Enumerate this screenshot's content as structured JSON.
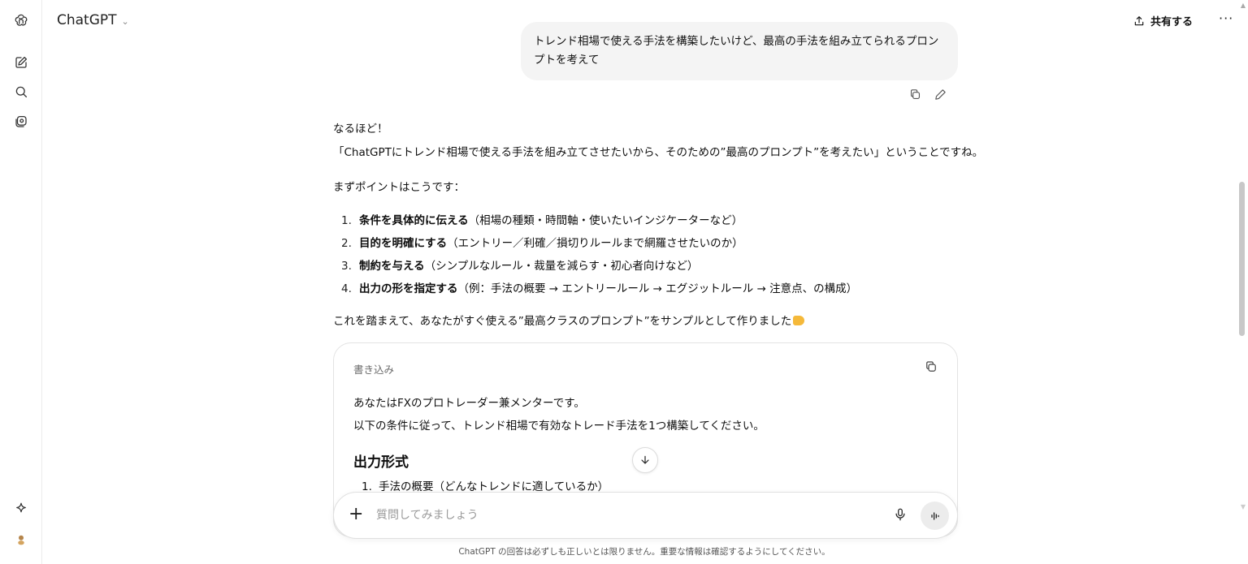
{
  "header": {
    "model_name": "ChatGPT",
    "share_label": "共有する",
    "more_label": "···"
  },
  "conversation": {
    "user_message": {
      "line1": "トレンド相場で使える手法を構築したいけど、最高の手法を組み立てられるプロン",
      "line2": "プトを考えて"
    },
    "assistant": {
      "intro1": "なるほど！",
      "intro2": "「ChatGPTにトレンド相場で使える手法を組み立てさせたいから、そのための”最高のプロンプト”を考えたい」ということですね。",
      "points_intro": "まずポイントはこうです：",
      "points": [
        {
          "num": "1.",
          "bold": "条件を具体的に伝える",
          "rest": "（相場の種類・時間軸・使いたいインジケーターなど）"
        },
        {
          "num": "2.",
          "bold": "目的を明確にする",
          "rest": "（エントリー／利確／損切りルールまで網羅させたいのか）"
        },
        {
          "num": "3.",
          "bold": "制約を与える",
          "rest": "（シンプルなルール・裁量を減らす・初心者向けなど）"
        },
        {
          "num": "4.",
          "bold": "出力の形を指定する",
          "rest": "（例：手法の概要 → エントリールール → エグジットルール → 注意点、の構成）"
        }
      ],
      "outro": "これを踏まえて、あなたがすぐ使える”最高クラスのプロンプト”をサンプルとして作りました",
      "outro_emoji": "backhand-index-pointing-down-emoji"
    },
    "card": {
      "title": "書き込み",
      "line1": "あなたはFXのプロトレーダー兼メンターです。",
      "line2": "以下の条件に従って、トレンド相場で有効なトレード手法を1つ構築してください。",
      "heading": "出力形式",
      "list_num": "1.",
      "list_item": "手法の概要（どんなトレンドに適しているか）"
    }
  },
  "composer": {
    "placeholder": "質問してみましょう",
    "value": ""
  },
  "footer": {
    "disclaimer": "ChatGPT の回答は必ずしも正しいとは限りません。重要な情報は確認するようにしてください。"
  },
  "icons": [
    "openai-logo-icon",
    "new-chat-icon",
    "search-icon",
    "library-icon",
    "sparkle-icon",
    "avatar",
    "share-icon",
    "copy-icon",
    "edit-icon",
    "arrow-down-icon",
    "plus-icon",
    "microphone-icon",
    "voice-mode-icon"
  ]
}
